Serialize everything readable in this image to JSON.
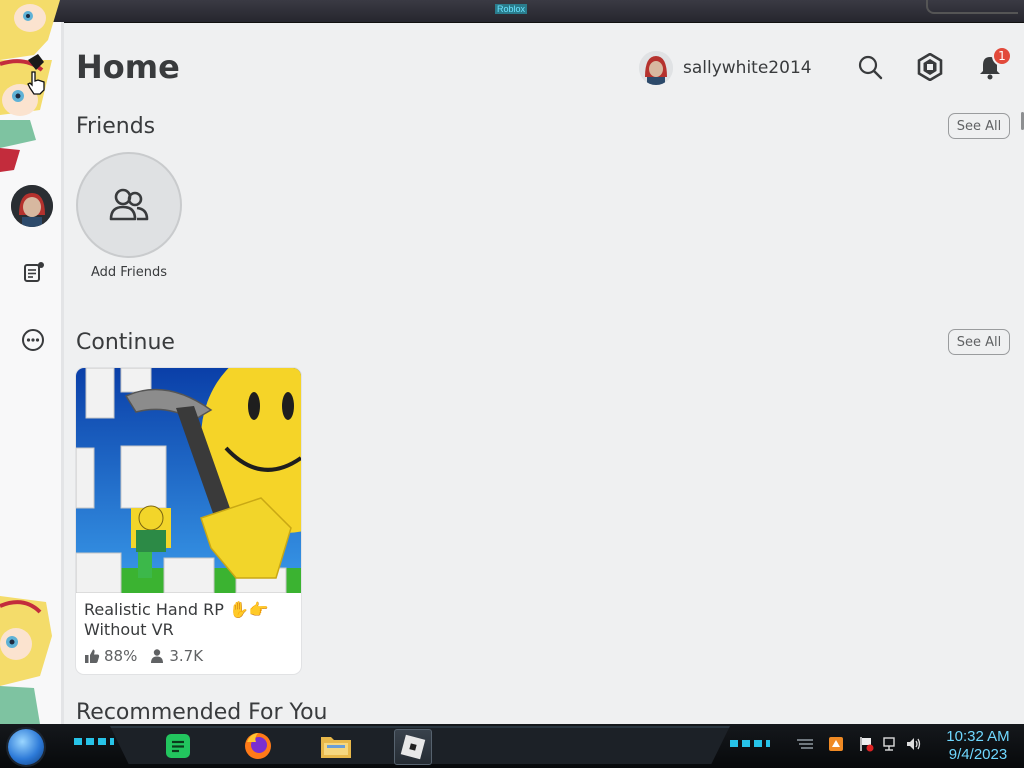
{
  "window": {
    "title": "Roblox"
  },
  "header": {
    "page_title": "Home",
    "username": "sallywhite2014",
    "notification_count": "1"
  },
  "friends": {
    "title": "Friends",
    "see_all": "See All",
    "add_friends_label": "Add Friends"
  },
  "continue": {
    "title": "Continue",
    "see_all": "See All",
    "games": [
      {
        "name": "Realistic Hand RP ✋👉 Without VR",
        "rating": "88%",
        "players": "3.7K"
      }
    ]
  },
  "recommended": {
    "title": "Recommended For You"
  },
  "taskbar": {
    "time": "10:32 AM",
    "date": "9/4/2023"
  },
  "colors": {
    "background": "#eff0f1",
    "text": "#393b3d",
    "badge": "#e24a3b",
    "clock": "#6fd8ff"
  }
}
